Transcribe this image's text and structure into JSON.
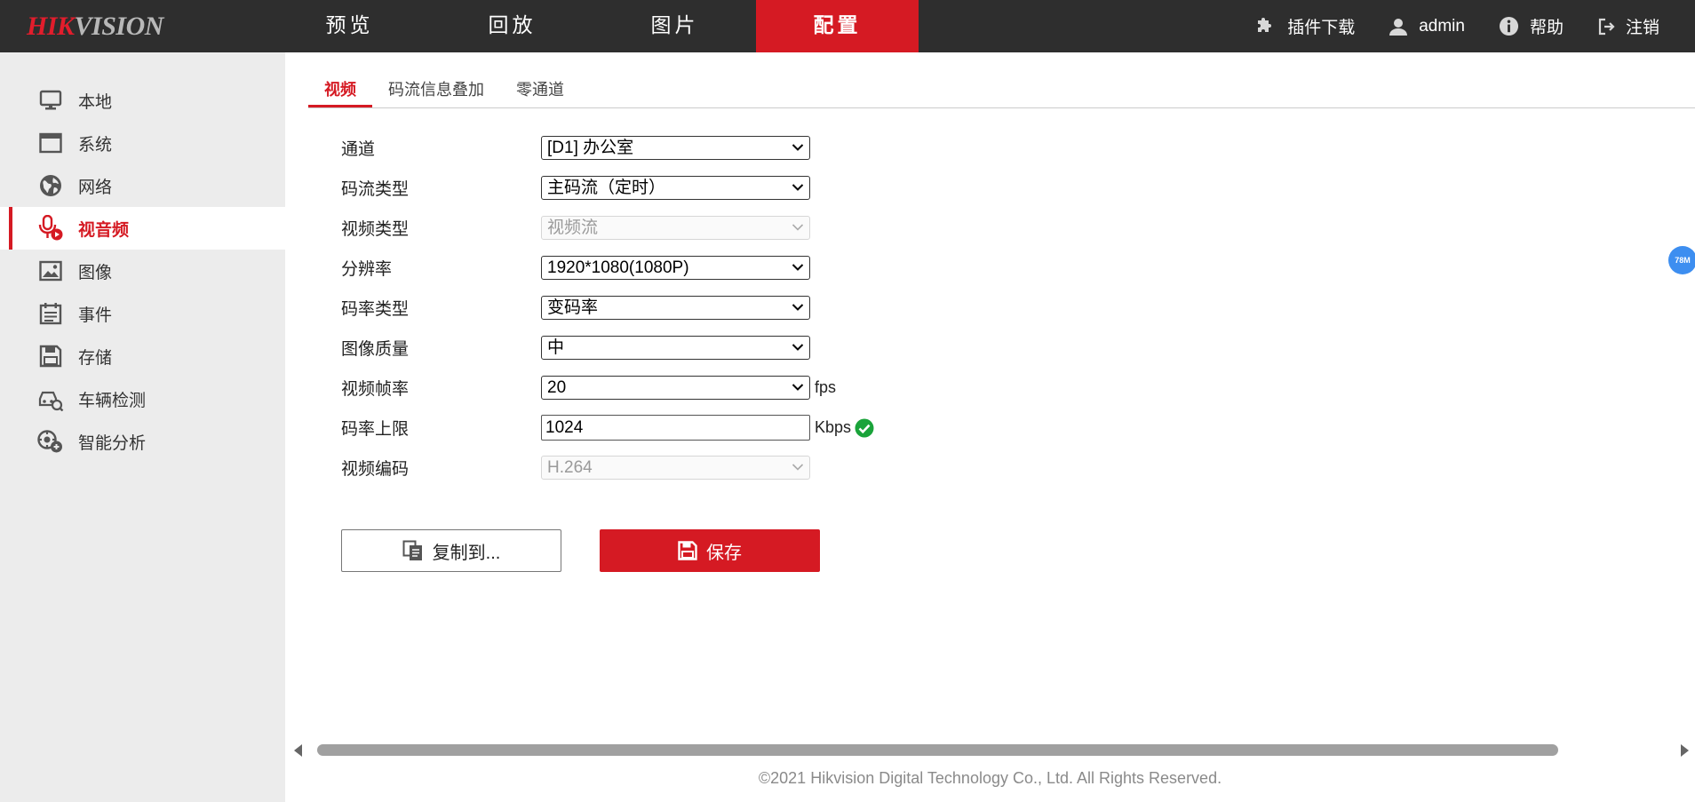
{
  "header": {
    "logo_hik": "HIK",
    "logo_vision": "VISION",
    "nav": [
      {
        "label": "预览"
      },
      {
        "label": "回放"
      },
      {
        "label": "图片"
      },
      {
        "label": "配置"
      }
    ],
    "plugin_label": "插件下载",
    "user_label": "admin",
    "help_label": "帮助",
    "logout_label": "注销"
  },
  "sidebar": {
    "items": [
      {
        "label": "本地",
        "icon": "monitor-icon"
      },
      {
        "label": "系统",
        "icon": "window-icon"
      },
      {
        "label": "网络",
        "icon": "globe-icon"
      },
      {
        "label": "视音频",
        "icon": "microphone-icon",
        "active": true
      },
      {
        "label": "图像",
        "icon": "image-icon"
      },
      {
        "label": "事件",
        "icon": "calendar-icon"
      },
      {
        "label": "存储",
        "icon": "floppy-icon"
      },
      {
        "label": "车辆检测",
        "icon": "car-search-icon"
      },
      {
        "label": "智能分析",
        "icon": "smart-analysis-icon"
      }
    ]
  },
  "tabs": [
    {
      "label": "视频",
      "active": true
    },
    {
      "label": "码流信息叠加"
    },
    {
      "label": "零通道"
    }
  ],
  "form": {
    "channel": {
      "label": "通道",
      "value": "[D1] 办公室"
    },
    "stream_type": {
      "label": "码流类型",
      "value": "主码流（定时）"
    },
    "video_type": {
      "label": "视频类型",
      "value": "视频流",
      "disabled": true
    },
    "resolution": {
      "label": "分辨率",
      "value": "1920*1080(1080P)"
    },
    "bitrate_type": {
      "label": "码率类型",
      "value": "变码率"
    },
    "image_quality": {
      "label": "图像质量",
      "value": "中"
    },
    "frame_rate": {
      "label": "视频帧率",
      "value": "20",
      "unit": "fps"
    },
    "bitrate_limit": {
      "label": "码率上限",
      "value": "1024",
      "unit": "Kbps"
    },
    "video_encoding": {
      "label": "视频编码",
      "value": "H.264",
      "disabled": true
    }
  },
  "buttons": {
    "copy_label": "复制到...",
    "save_label": "保存"
  },
  "footer": "©2021 Hikvision Digital Technology Co., Ltd. All Rights Reserved.",
  "float_badge": "78M",
  "colors": {
    "accent": "#d51a23",
    "topbar": "#2e2e2e",
    "sidebar": "#ececec",
    "success": "#1aa33a",
    "badge": "#3d8ef0"
  }
}
